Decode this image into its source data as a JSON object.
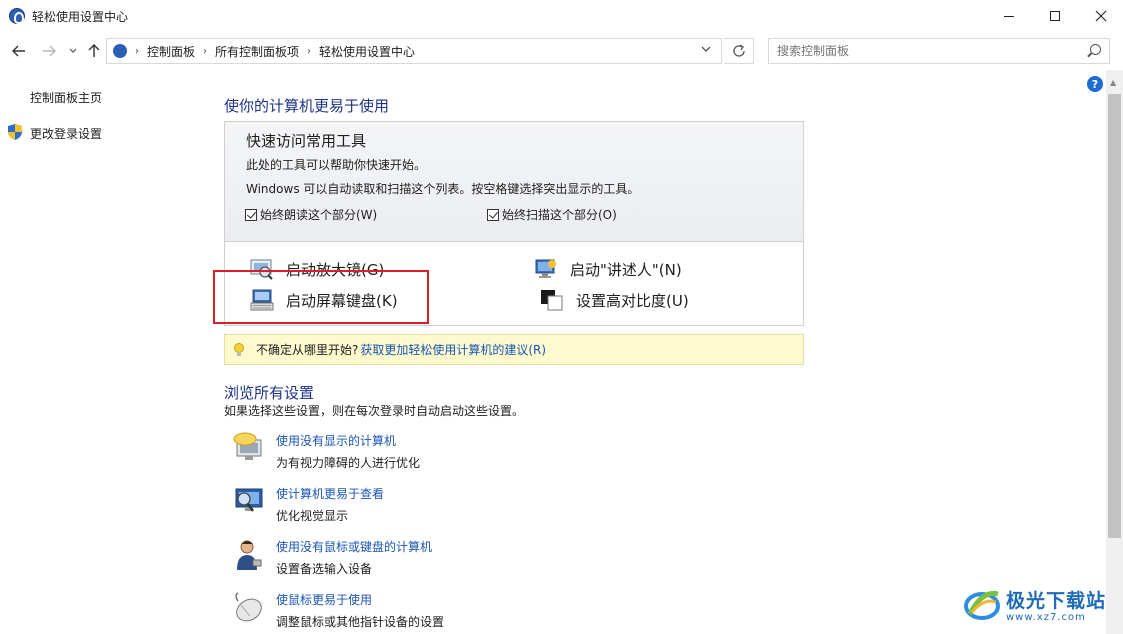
{
  "window": {
    "title": "轻松使用设置中心"
  },
  "nav": {
    "breadcrumbs": [
      "控制面板",
      "所有控制面板项",
      "轻松使用设置中心"
    ],
    "search_placeholder": "搜索控制面板"
  },
  "sidebar": {
    "items": [
      {
        "label": "控制面板主页"
      },
      {
        "label": "更改登录设置"
      }
    ]
  },
  "main": {
    "heading": "使你的计算机更易于使用",
    "quick_access": {
      "title": "快速访问常用工具",
      "desc1": "此处的工具可以帮助你快速开始。",
      "desc2": "Windows 可以自动读取和扫描这个列表。按空格键选择突出显示的工具。",
      "checkbox_read": "始终朗读这个部分(W)",
      "checkbox_scan": "始终扫描这个部分(O)",
      "tools": [
        {
          "label": "启动放大镜(G)"
        },
        {
          "label": "启动\"讲述人\"(N)"
        },
        {
          "label": "启动屏幕键盘(K)"
        },
        {
          "label": "设置高对比度(U)"
        }
      ]
    },
    "tip": {
      "text": "不确定从哪里开始?",
      "link": "获取更加轻松使用计算机的建议(R)"
    },
    "browse": {
      "heading": "浏览所有设置",
      "subtitle": "如果选择这些设置，则在每次登录时自动启动这些设置。",
      "items": [
        {
          "link": "使用没有显示的计算机",
          "desc": "为有视力障碍的人进行优化"
        },
        {
          "link": "使计算机更易于查看",
          "desc": "优化视觉显示"
        },
        {
          "link": "使用没有鼠标或键盘的计算机",
          "desc": "设置备选输入设备"
        },
        {
          "link": "使鼠标更易于使用",
          "desc": "调整鼠标或其他指针设备的设置"
        }
      ]
    }
  },
  "watermark": {
    "name": "极光下载站",
    "url": "www.xz7.com"
  },
  "colors": {
    "link": "#1a55b3",
    "heading": "#1e3287",
    "highlight_box": "#d61f26",
    "tip_bg": "#fdfbce"
  }
}
